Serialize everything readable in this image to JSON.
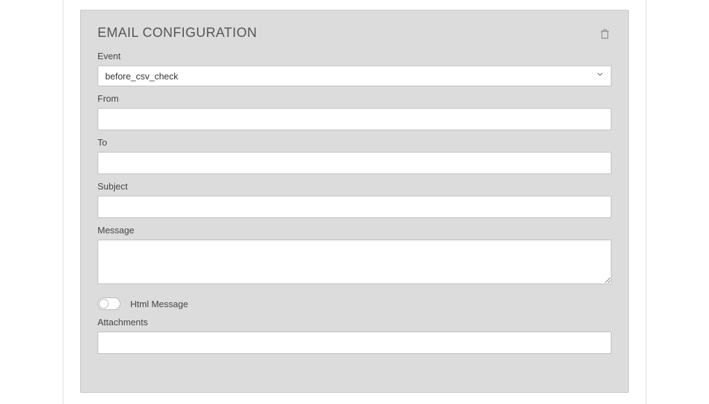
{
  "panel": {
    "title": "EMAIL CONFIGURATION"
  },
  "fields": {
    "event": {
      "label": "Event",
      "value": "before_csv_check"
    },
    "from": {
      "label": "From",
      "value": ""
    },
    "to": {
      "label": "To",
      "value": ""
    },
    "subject": {
      "label": "Subject",
      "value": ""
    },
    "message": {
      "label": "Message",
      "value": ""
    },
    "htmlMessage": {
      "label": "Html Message",
      "enabled": false
    },
    "attachments": {
      "label": "Attachments",
      "value": ""
    }
  }
}
